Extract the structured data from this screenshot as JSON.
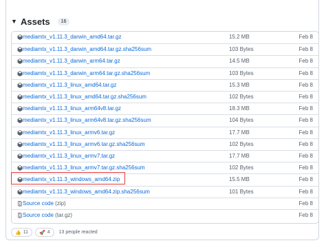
{
  "assets": {
    "title": "Assets",
    "count": "16",
    "rows": [
      {
        "name": "mediamtx_v1.11.3_darwin_amd64.tar.gz",
        "size": "15.2 MB",
        "date": "Feb 8"
      },
      {
        "name": "mediamtx_v1.11.3_darwin_amd64.tar.gz.sha256sum",
        "size": "103 Bytes",
        "date": "Feb 8"
      },
      {
        "name": "mediamtx_v1.11.3_darwin_arm64.tar.gz",
        "size": "14.5 MB",
        "date": "Feb 8"
      },
      {
        "name": "mediamtx_v1.11.3_darwin_arm64.tar.gz.sha256sum",
        "size": "103 Bytes",
        "date": "Feb 8"
      },
      {
        "name": "mediamtx_v1.11.3_linux_amd64.tar.gz",
        "size": "15.3 MB",
        "date": "Feb 8"
      },
      {
        "name": "mediamtx_v1.11.3_linux_amd64.tar.gz.sha256sum",
        "size": "102 Bytes",
        "date": "Feb 8"
      },
      {
        "name": "mediamtx_v1.11.3_linux_arm64v8.tar.gz",
        "size": "18.3 MB",
        "date": "Feb 8"
      },
      {
        "name": "mediamtx_v1.11.3_linux_arm64v8.tar.gz.sha256sum",
        "size": "104 Bytes",
        "date": "Feb 8"
      },
      {
        "name": "mediamtx_v1.11.3_linux_armv6.tar.gz",
        "size": "17.7 MB",
        "date": "Feb 8"
      },
      {
        "name": "mediamtx_v1.11.3_linux_armv6.tar.gz.sha256sum",
        "size": "102 Bytes",
        "date": "Feb 8"
      },
      {
        "name": "mediamtx_v1.11.3_linux_armv7.tar.gz",
        "size": "17.7 MB",
        "date": "Feb 8"
      },
      {
        "name": "mediamtx_v1.11.3_linux_armv7.tar.gz.sha256sum",
        "size": "102 Bytes",
        "date": "Feb 8"
      },
      {
        "name": "mediamtx_v1.11.3_windows_amd64.zip",
        "size": "15.5 MB",
        "date": "Feb 8"
      },
      {
        "name": "mediamtx_v1.11.3_windows_amd64.zip.sha256sum",
        "size": "101 Bytes",
        "date": "Feb 8"
      }
    ],
    "source_rows": [
      {
        "label": "Source code",
        "ext": "(zip)",
        "date": "Feb 8"
      },
      {
        "label": "Source code",
        "ext": "(tar.gz)",
        "date": "Feb 8"
      }
    ]
  },
  "reactions": {
    "thumbs_up_count": "11",
    "rocket_count": "4",
    "summary": "13 people reacted"
  },
  "colors": {
    "link": "#0969da",
    "muted": "#57606a",
    "highlight": "#e03b3b"
  },
  "icons": {
    "package": "package-icon",
    "file_zip": "file-zip-icon",
    "caret": "triangle-down-icon"
  }
}
